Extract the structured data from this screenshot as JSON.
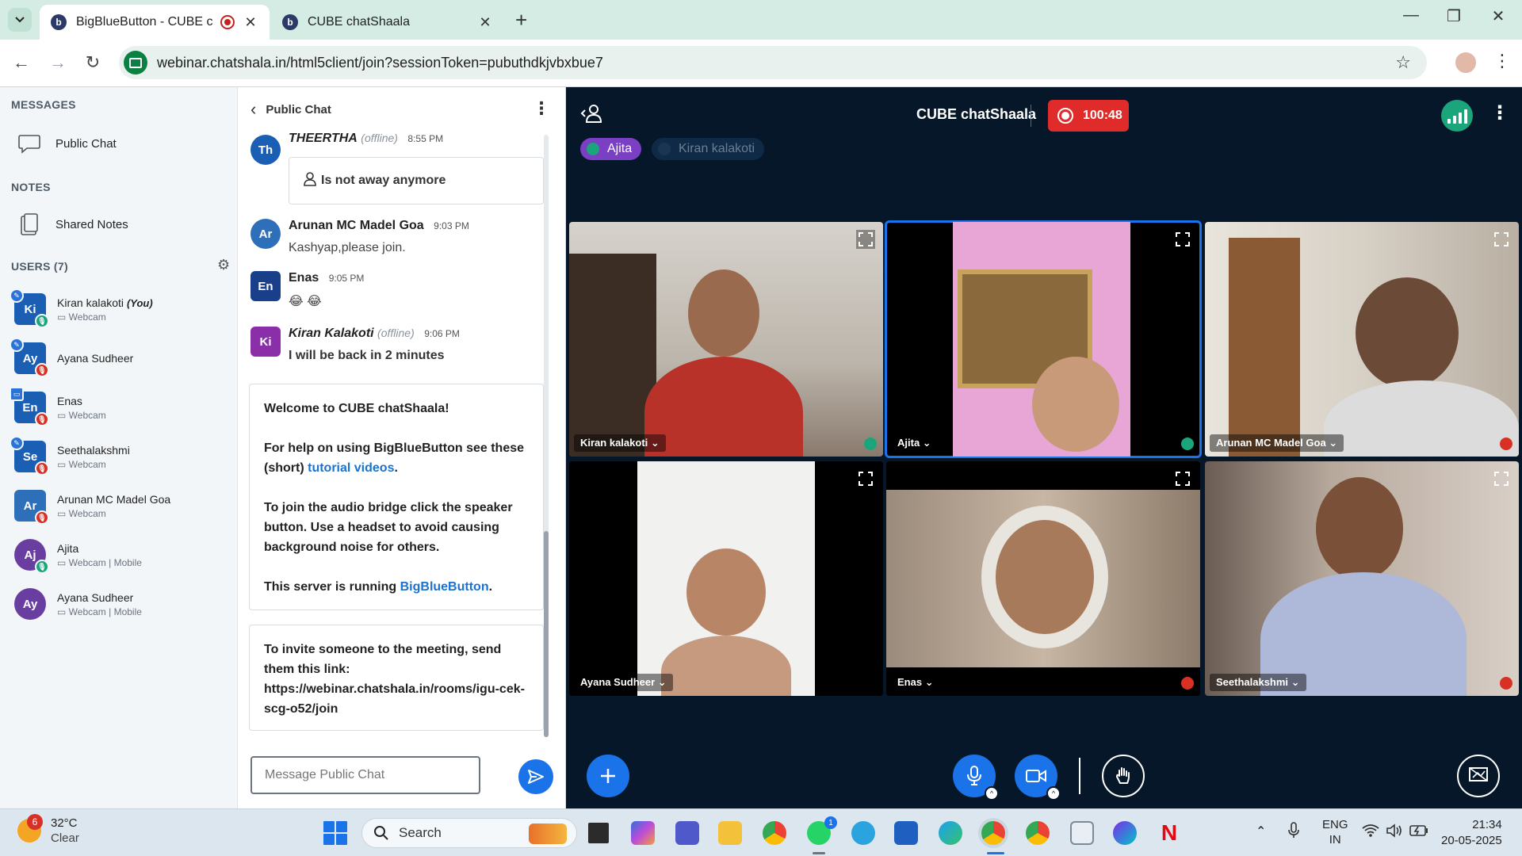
{
  "browser": {
    "tabs": [
      {
        "title": "BigBlueButton - CUBE chatS",
        "active": true
      },
      {
        "title": "CUBE chatShaala",
        "active": false
      }
    ],
    "url": "webinar.chatshala.in/html5client/join?sessionToken=pubuthdkjvbxbue7"
  },
  "sidebar": {
    "messages_title": "MESSAGES",
    "public_chat": "Public Chat",
    "notes_title": "NOTES",
    "shared_notes": "Shared Notes",
    "users_title": "USERS (7)",
    "users": [
      {
        "initials": "Ki",
        "name": "Kiran kalakoti",
        "you": "(You)",
        "sub": "Webcam",
        "color": "#1a5fb4"
      },
      {
        "initials": "Ay",
        "name": "Ayana Sudheer",
        "sub": "",
        "color": "#1a5fb4"
      },
      {
        "initials": "En",
        "name": "Enas",
        "sub": "Webcam",
        "color": "#1a5fb4"
      },
      {
        "initials": "Se",
        "name": "Seethalakshmi",
        "sub": "Webcam",
        "color": "#1a5fb4"
      },
      {
        "initials": "Ar",
        "name": "Arunan MC Madel Goa",
        "sub": "Webcam",
        "color": "#2d6fb8"
      },
      {
        "initials": "Aj",
        "name": "Ajita",
        "sub": "Webcam | Mobile",
        "color": "#6a3ea1"
      },
      {
        "initials": "Ay",
        "name": "Ayana Sudheer",
        "sub": "Webcam | Mobile",
        "color": "#6a3ea1"
      }
    ]
  },
  "chat": {
    "title": "Public Chat",
    "messages": [
      {
        "initials": "Th",
        "name": "THEERTHA",
        "offline": "(offline)",
        "time": "8:55 PM",
        "status": "Is not away anymore",
        "color": "#1a5fb4"
      },
      {
        "initials": "Ar",
        "name": "Arunan MC Madel Goa",
        "time": "9:03 PM",
        "text": "Kashyap,please join.",
        "color": "#2d6fb8"
      },
      {
        "initials": "En",
        "name": "Enas",
        "time": "9:05 PM",
        "text": "😂 😂",
        "color": "#1a3f8a"
      },
      {
        "initials": "Ki",
        "name": "Kiran Kalakoti",
        "offline": "(offline)",
        "time": "9:06 PM",
        "text": "I will be back in 2 minutes",
        "color": "#8b2fa8"
      }
    ],
    "welcome": {
      "line1_pre": "Welcome to ",
      "line1_bold": "CUBE chatShaala",
      "line1_post": "!",
      "line2_pre": "For help on using BigBlueButton see these (short) ",
      "line2_link": "tutorial videos",
      "line2_post": ".",
      "line3": "To join the audio bridge click the speaker button. Use a headset to avoid causing background noise for others.",
      "line4_pre": "This server is running ",
      "line4_link": "BigBlueButton",
      "line4_post": "."
    },
    "invite_text": "To invite someone to the meeting, send them this link:",
    "invite_link": "https://webinar.chatshala.in/rooms/igu-cek-scg-o52/join",
    "input_placeholder": "Message Public Chat"
  },
  "meeting": {
    "title": "CUBE chatShaala",
    "record_time": "100:48",
    "talkers": [
      {
        "name": "Ajita",
        "active": true
      },
      {
        "name": "Kiran kalakoti",
        "active": false
      }
    ],
    "tiles": [
      {
        "name": "Kiran kalakoti",
        "mic": "on"
      },
      {
        "name": "Ajita",
        "mic": "on"
      },
      {
        "name": "Arunan MC Madel Goa",
        "mic": "muted"
      },
      {
        "name": "Ayana Sudheer",
        "mic": "none"
      },
      {
        "name": "Enas",
        "mic": "muted"
      },
      {
        "name": "Seethalakshmi",
        "mic": "muted"
      }
    ]
  },
  "taskbar": {
    "weather_badge": "6",
    "temperature": "32°C",
    "condition": "Clear",
    "search_label": "Search",
    "whatsapp_badge": "1",
    "lang_top": "ENG",
    "lang_bottom": "IN",
    "time": "21:34",
    "date": "20-05-2025"
  }
}
